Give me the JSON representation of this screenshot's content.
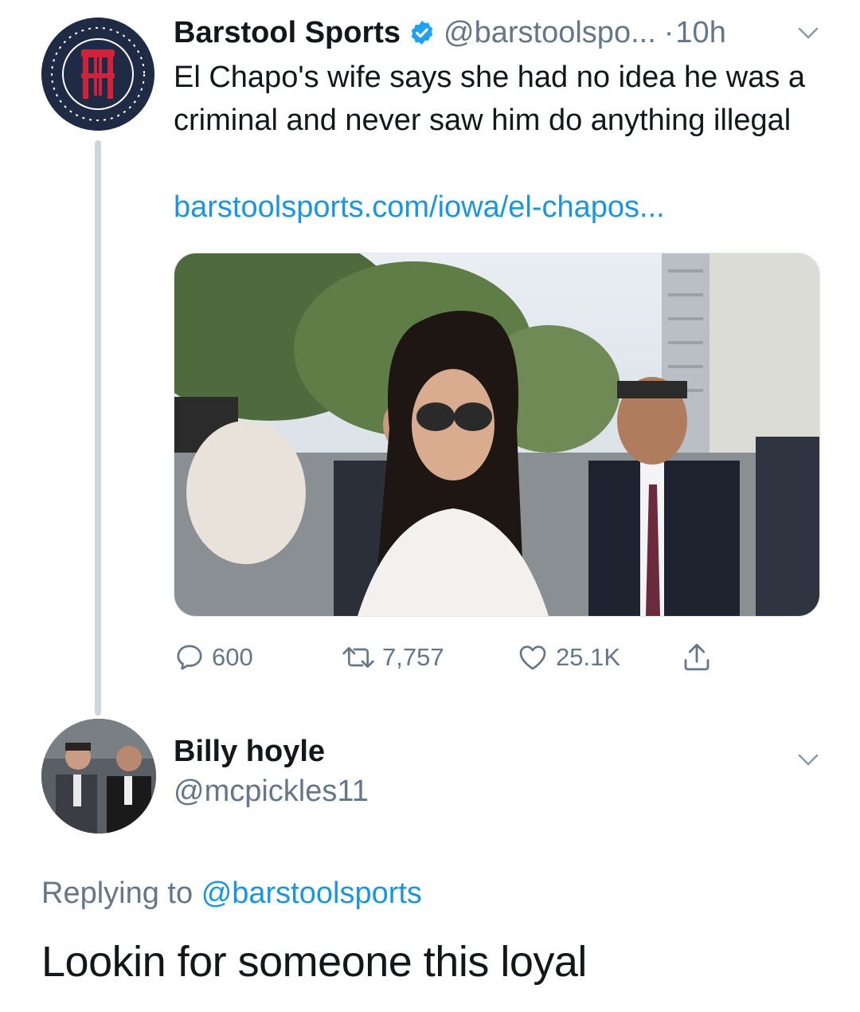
{
  "original_tweet": {
    "display_name": "Barstool Sports",
    "handle": "@barstoolspo...",
    "separator": "·",
    "time": "10h",
    "verified": true,
    "text": "El Chapo's wife says she had no idea he was a criminal and never saw him do anything illegal",
    "link_text": "barstoolsports.com/iowa/el-chapos...",
    "actions": {
      "replies": "600",
      "retweets": "7,757",
      "likes": "25.1K"
    }
  },
  "reply": {
    "display_name": "Billy hoyle",
    "handle": "@mcpickles11",
    "replying_prefix": "Replying to",
    "replying_to": "@barstoolsports",
    "text": "Lookin for someone this loyal"
  },
  "colors": {
    "text_primary": "#14171a",
    "text_secondary": "#657786",
    "link": "#1b95e0",
    "verified": "#1da1f2",
    "thread_line": "#ccd6dd"
  },
  "icons": [
    "verified-badge-icon",
    "chevron-down-icon",
    "reply-icon",
    "retweet-icon",
    "like-icon",
    "share-icon"
  ]
}
